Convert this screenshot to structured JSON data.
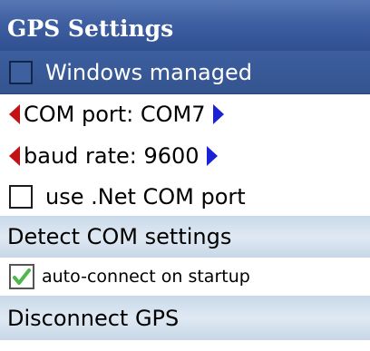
{
  "header": {
    "title": "GPS Settings"
  },
  "rows": {
    "windows_managed": {
      "label": "Windows managed",
      "checked": false
    },
    "com_port": {
      "label": "COM port: COM7"
    },
    "baud_rate": {
      "label": "baud rate: 9600"
    },
    "use_net_com": {
      "label": "use .Net COM port",
      "checked": false
    },
    "detect": {
      "label": "Detect COM settings"
    },
    "auto_connect": {
      "label": "auto-connect on startup",
      "checked": true
    },
    "disconnect": {
      "label": "Disconnect GPS"
    }
  },
  "colors": {
    "header": "#3e5fa1",
    "selected": "#3d5e9f",
    "left_arrow": "#c21216",
    "right_arrow": "#1a22d8",
    "check": "#4eb84a",
    "action_band": "#d4e2f0"
  }
}
